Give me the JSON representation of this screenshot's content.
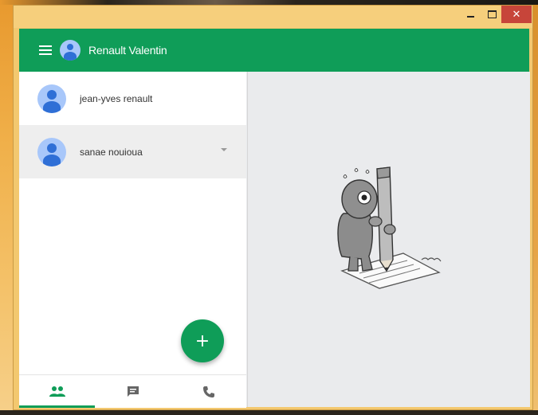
{
  "app": {
    "user_name": "Renault Valentin"
  },
  "window_controls": {
    "minimize": "minimize",
    "maximize": "maximize",
    "close": "✕"
  },
  "contacts": [
    {
      "name": "jean-yves renault"
    },
    {
      "name": "sanae nouioua"
    }
  ],
  "fab": {
    "label": "+"
  },
  "bottom_nav": {
    "tabs": [
      {
        "id": "contacts",
        "icon": "people-icon",
        "active": true
      },
      {
        "id": "messages",
        "icon": "chat-icon",
        "active": false
      },
      {
        "id": "calls",
        "icon": "phone-icon",
        "active": false
      }
    ]
  },
  "colors": {
    "primary": "#0f9d58",
    "avatar_bg": "#a8c7fa",
    "avatar_fg": "#2f6fd6",
    "close_red": "#c7453a"
  },
  "illustration": {
    "icon": "person-with-pencil-illustration"
  }
}
